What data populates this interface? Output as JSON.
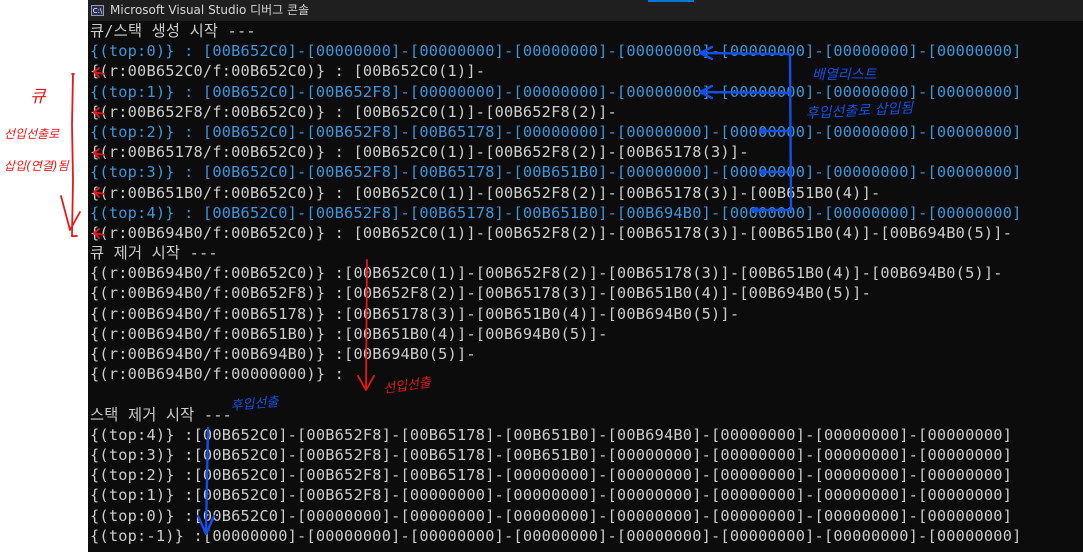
{
  "window": {
    "icon_text": "C:\\",
    "title": "Microsoft Visual Studio 디버그 콘솔"
  },
  "console_lines": [
    {
      "text": "큐/스택 생성 시작 ---",
      "tone": "plain"
    },
    {
      "text": "{(top:0)} : [00B652C0]-[00000000]-[00000000]-[00000000]-[00000000]-[00000000]-[00000000]-[00000000]",
      "tone": "teal"
    },
    {
      "text": "{(r:00B652C0/f:00B652C0)} : [00B652C0(1)]-",
      "tone": "plain"
    },
    {
      "text": "{(top:1)} : [00B652C0]-[00B652F8]-[00000000]-[00000000]-[00000000]-[00000000]-[00000000]-[00000000]",
      "tone": "teal"
    },
    {
      "text": "{(r:00B652F8/f:00B652C0)} : [00B652C0(1)]-[00B652F8(2)]-",
      "tone": "plain"
    },
    {
      "text": "{(top:2)} : [00B652C0]-[00B652F8]-[00B65178]-[00000000]-[00000000]-[00000000]-[00000000]-[00000000]",
      "tone": "teal"
    },
    {
      "text": "{(r:00B65178/f:00B652C0)} : [00B652C0(1)]-[00B652F8(2)]-[00B65178(3)]-",
      "tone": "plain"
    },
    {
      "text": "{(top:3)} : [00B652C0]-[00B652F8]-[00B65178]-[00B651B0]-[00000000]-[00000000]-[00000000]-[00000000]",
      "tone": "teal"
    },
    {
      "text": "{(r:00B651B0/f:00B652C0)} : [00B652C0(1)]-[00B652F8(2)]-[00B65178(3)]-[00B651B0(4)]-",
      "tone": "plain"
    },
    {
      "text": "{(top:4)} : [00B652C0]-[00B652F8]-[00B65178]-[00B651B0]-[00B694B0]-[00000000]-[00000000]-[00000000]",
      "tone": "teal"
    },
    {
      "text": "{(r:00B694B0/f:00B652C0)} : [00B652C0(1)]-[00B652F8(2)]-[00B65178(3)]-[00B651B0(4)]-[00B694B0(5)]-",
      "tone": "plain"
    },
    {
      "text": "큐 제거 시작 ---",
      "tone": "plain"
    },
    {
      "text": "{(r:00B694B0/f:00B652C0)} :[00B652C0(1)]-[00B652F8(2)]-[00B65178(3)]-[00B651B0(4)]-[00B694B0(5)]-",
      "tone": "plain"
    },
    {
      "text": "{(r:00B694B0/f:00B652F8)} :[00B652F8(2)]-[00B65178(3)]-[00B651B0(4)]-[00B694B0(5)]-",
      "tone": "plain"
    },
    {
      "text": "{(r:00B694B0/f:00B65178)} :[00B65178(3)]-[00B651B0(4)]-[00B694B0(5)]-",
      "tone": "plain"
    },
    {
      "text": "{(r:00B694B0/f:00B651B0)} :[00B651B0(4)]-[00B694B0(5)]-",
      "tone": "plain"
    },
    {
      "text": "{(r:00B694B0/f:00B694B0)} :[00B694B0(5)]-",
      "tone": "plain"
    },
    {
      "text": "{(r:00B694B0/f:00000000)} :",
      "tone": "plain"
    },
    {
      "text": "",
      "tone": "plain"
    },
    {
      "text": "스택 제거 시작 ---",
      "tone": "plain"
    },
    {
      "text": "{(top:4)} :[00B652C0]-[00B652F8]-[00B65178]-[00B651B0]-[00B694B0]-[00000000]-[00000000]-[00000000]",
      "tone": "plain"
    },
    {
      "text": "{(top:3)} :[00B652C0]-[00B652F8]-[00B65178]-[00B651B0]-[00000000]-[00000000]-[00000000]-[00000000]",
      "tone": "plain"
    },
    {
      "text": "{(top:2)} :[00B652C0]-[00B652F8]-[00B65178]-[00000000]-[00000000]-[00000000]-[00000000]-[00000000]",
      "tone": "plain"
    },
    {
      "text": "{(top:1)} :[00B652C0]-[00B652F8]-[00000000]-[00000000]-[00000000]-[00000000]-[00000000]-[00000000]",
      "tone": "plain"
    },
    {
      "text": "{(top:0)} :[00B652C0]-[00000000]-[00000000]-[00000000]-[00000000]-[00000000]-[00000000]-[00000000]",
      "tone": "plain"
    },
    {
      "text": "{(top:-1)} :[00000000]-[00000000]-[00000000]-[00000000]-[00000000]-[00000000]-[00000000]-[00000000]",
      "tone": "plain"
    }
  ],
  "annotations": {
    "left_queue_label": "큐",
    "left_note_line1": "선입선출로",
    "left_note_line2": "삽입(연결)됨",
    "array_stack_note": "배열리스트",
    "stack_push_note": "후입선출로 삽입됨",
    "fifo_note": "선입선출",
    "lifo_note": "후입선출"
  },
  "colors": {
    "console_bg": "#0c0c0c",
    "console_text": "#cccccc",
    "stack_line_text": "#3a96dd",
    "annotation_red": "#e81717",
    "annotation_blue": "#1450e6"
  }
}
